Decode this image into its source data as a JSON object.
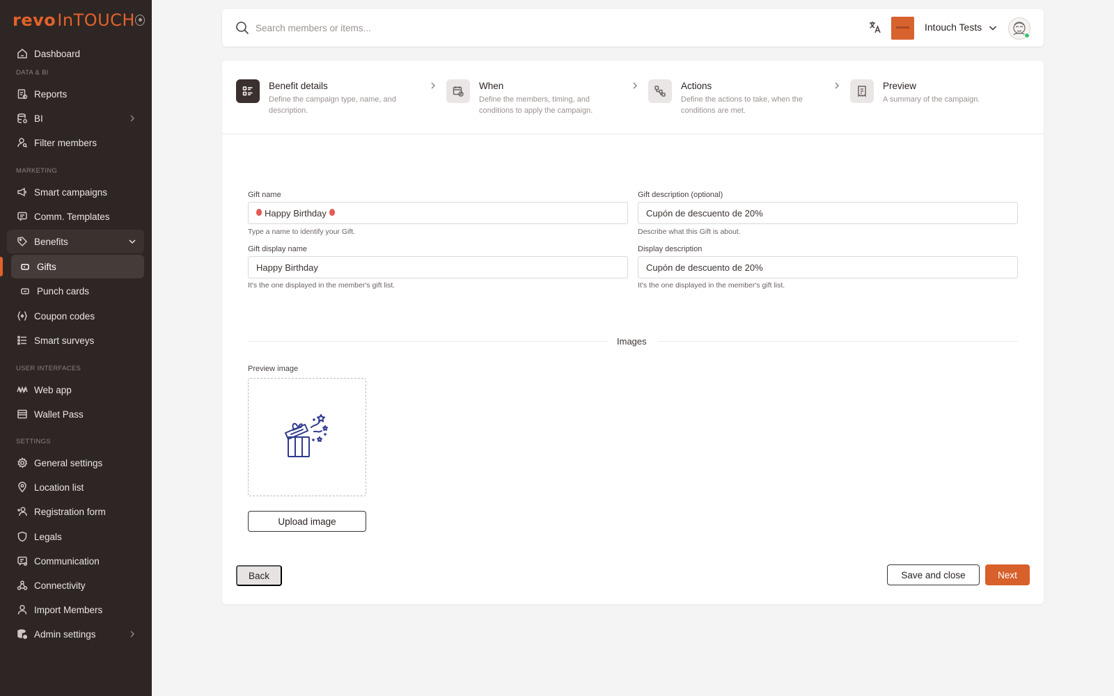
{
  "app": {
    "logo_prefix": "revo",
    "logo_in": "In",
    "logo_suffix": "TOUCH",
    "accent_color": "#e2622a"
  },
  "sidebar": {
    "sections": {
      "data_bi": "DATA & BI",
      "marketing": "MARKETING",
      "user_interfaces": "USER INTERFACES",
      "settings": "SETTINGS"
    },
    "items": {
      "dashboard": "Dashboard",
      "reports": "Reports",
      "bi": "BI",
      "filter_members": "Filter members",
      "smart_campaigns": "Smart campaigns",
      "comm_templates": "Comm. Templates",
      "benefits": "Benefits",
      "gifts": "Gifts",
      "punch_cards": "Punch cards",
      "coupon_codes": "Coupon codes",
      "smart_surveys": "Smart surveys",
      "web_app": "Web app",
      "wallet_pass": "Wallet Pass",
      "general_settings": "General settings",
      "location_list": "Location list",
      "registration_form": "Registration form",
      "legals": "Legals",
      "communication": "Communication",
      "connectivity": "Connectivity",
      "import_members": "Import Members",
      "admin_settings": "Admin settings"
    }
  },
  "topbar": {
    "search_placeholder": "Search members or items...",
    "org_name": "Intouch Tests"
  },
  "stepper": [
    {
      "title": "Benefit details",
      "desc": "Define the campaign type, name, and description.",
      "active": true
    },
    {
      "title": "When",
      "desc": "Define the members, timing, and conditions to apply the campaign.",
      "active": false
    },
    {
      "title": "Actions",
      "desc": "Define the actions to take, when the conditions are met.",
      "active": false
    },
    {
      "title": "Preview",
      "desc": "A summary of the campaign.",
      "active": false
    }
  ],
  "form": {
    "gift_name": {
      "label": "Gift name",
      "value": "Happy Birthday",
      "hint": "Type a name to identify your Gift."
    },
    "gift_description": {
      "label": "Gift description (optional)",
      "value": "Cupón de descuento de 20%",
      "hint": "Describe what this Gift is about."
    },
    "gift_display_name": {
      "label": "Gift display name",
      "value": "Happy Birthday",
      "hint": "It's the one displayed in the member's gift list."
    },
    "display_description": {
      "label": "Display description",
      "value": "Cupón de descuento de 20%",
      "hint": "It's the one displayed in the member's gift list."
    },
    "images_divider": "Images",
    "preview_image_label": "Preview image",
    "preview_image_icon": "gift-box-icon"
  },
  "buttons": {
    "upload": "Upload image",
    "back": "Back",
    "save_close": "Save and close",
    "next": "Next"
  }
}
